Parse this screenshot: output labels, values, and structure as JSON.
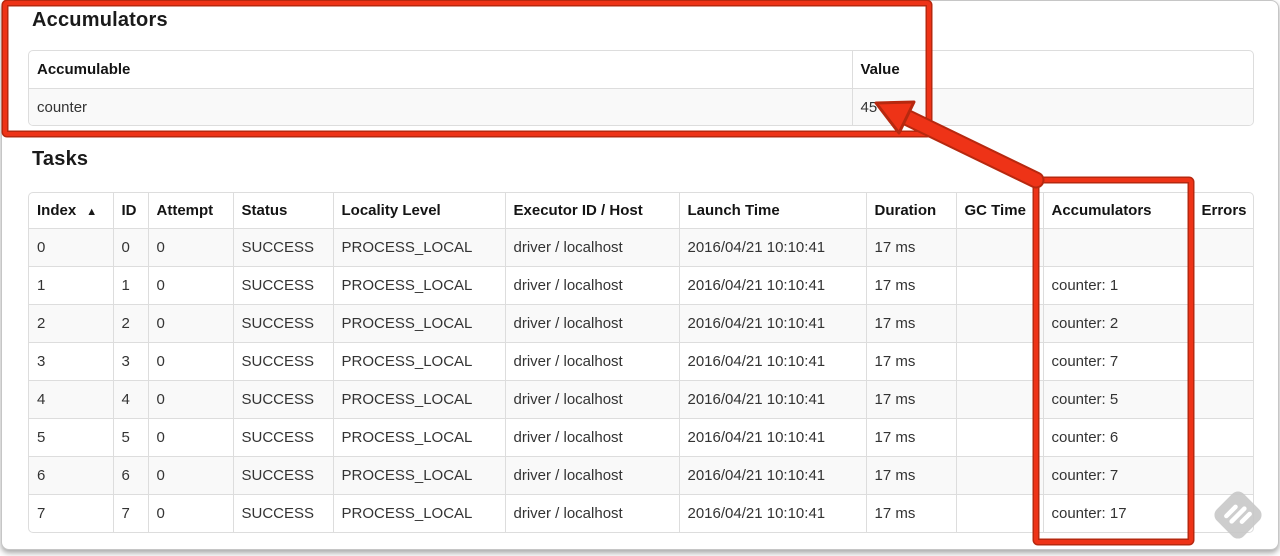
{
  "colors": {
    "annotation": "#ee3317",
    "annotation_outline": "#b7280f",
    "stripe": "#f9f9f9",
    "table_border": "#dddddd",
    "watermark_gray": "#c9c9c9"
  },
  "accumulators_section": {
    "title": "Accumulators",
    "table": {
      "headers": [
        "Accumulable",
        "Value"
      ],
      "rows": [
        [
          "counter",
          "45"
        ]
      ]
    }
  },
  "tasks_section": {
    "title": "Tasks",
    "table": {
      "headers": [
        "Index",
        "ID",
        "Attempt",
        "Status",
        "Locality Level",
        "Executor ID / Host",
        "Launch Time",
        "Duration",
        "GC Time",
        "Accumulators",
        "Errors"
      ],
      "sort_icon": "▲",
      "rows": [
        [
          "0",
          "0",
          "0",
          "SUCCESS",
          "PROCESS_LOCAL",
          "driver / localhost",
          "2016/04/21 10:10:41",
          "17 ms",
          "",
          "",
          ""
        ],
        [
          "1",
          "1",
          "0",
          "SUCCESS",
          "PROCESS_LOCAL",
          "driver / localhost",
          "2016/04/21 10:10:41",
          "17 ms",
          "",
          "counter: 1",
          ""
        ],
        [
          "2",
          "2",
          "0",
          "SUCCESS",
          "PROCESS_LOCAL",
          "driver / localhost",
          "2016/04/21 10:10:41",
          "17 ms",
          "",
          "counter: 2",
          ""
        ],
        [
          "3",
          "3",
          "0",
          "SUCCESS",
          "PROCESS_LOCAL",
          "driver / localhost",
          "2016/04/21 10:10:41",
          "17 ms",
          "",
          "counter: 7",
          ""
        ],
        [
          "4",
          "4",
          "0",
          "SUCCESS",
          "PROCESS_LOCAL",
          "driver / localhost",
          "2016/04/21 10:10:41",
          "17 ms",
          "",
          "counter: 5",
          ""
        ],
        [
          "5",
          "5",
          "0",
          "SUCCESS",
          "PROCESS_LOCAL",
          "driver / localhost",
          "2016/04/21 10:10:41",
          "17 ms",
          "",
          "counter: 6",
          ""
        ],
        [
          "6",
          "6",
          "0",
          "SUCCESS",
          "PROCESS_LOCAL",
          "driver / localhost",
          "2016/04/21 10:10:41",
          "17 ms",
          "",
          "counter: 7",
          ""
        ],
        [
          "7",
          "7",
          "0",
          "SUCCESS",
          "PROCESS_LOCAL",
          "driver / localhost",
          "2016/04/21 10:10:41",
          "17 ms",
          "",
          "counter: 17",
          ""
        ]
      ]
    }
  }
}
